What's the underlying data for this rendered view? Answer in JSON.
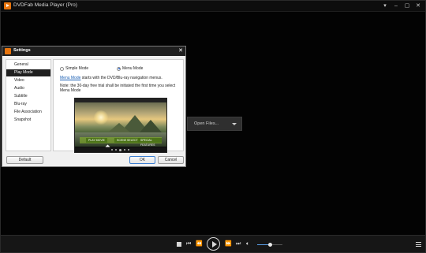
{
  "window": {
    "title": "DVDFab Media Player (Pro)",
    "buttons": [
      "▾",
      "–",
      "▢",
      "✕"
    ]
  },
  "open_files": {
    "label": "Open Files..."
  },
  "settings": {
    "title": "Settings",
    "close": "✕",
    "nav": [
      "General",
      "Play Mode",
      "Video",
      "Audio",
      "Subtitle",
      "Blu-ray",
      "File Association",
      "Snapshot"
    ],
    "active_nav": "Play Mode",
    "modes": {
      "simple": "Simple Mode",
      "menu": "Menu Mode",
      "selected": "Menu Mode"
    },
    "description_link": "Menu Mode",
    "description_rest": " starts with the DVD/Blu-ray navigation menus.",
    "note": "Note: the 30-day free trial shall be initiated the first time you select Menu Mode",
    "preview_menu": [
      "PLAY MOVIE",
      "SCENE SELECT",
      "SPECIAL FEATURES"
    ],
    "buttons": {
      "default": "Default",
      "ok": "OK",
      "cancel": "Cancel"
    }
  },
  "controls": {
    "icons": [
      "stop-icon",
      "previous-icon",
      "rewind-icon",
      "play-icon",
      "fast-forward-icon",
      "next-icon",
      "volume-icon",
      "playlist-icon"
    ],
    "volume_level": 0.5
  },
  "colors": {
    "accent": "#e8740c",
    "link": "#1a5fb4",
    "selection": "#1f1f1f"
  }
}
